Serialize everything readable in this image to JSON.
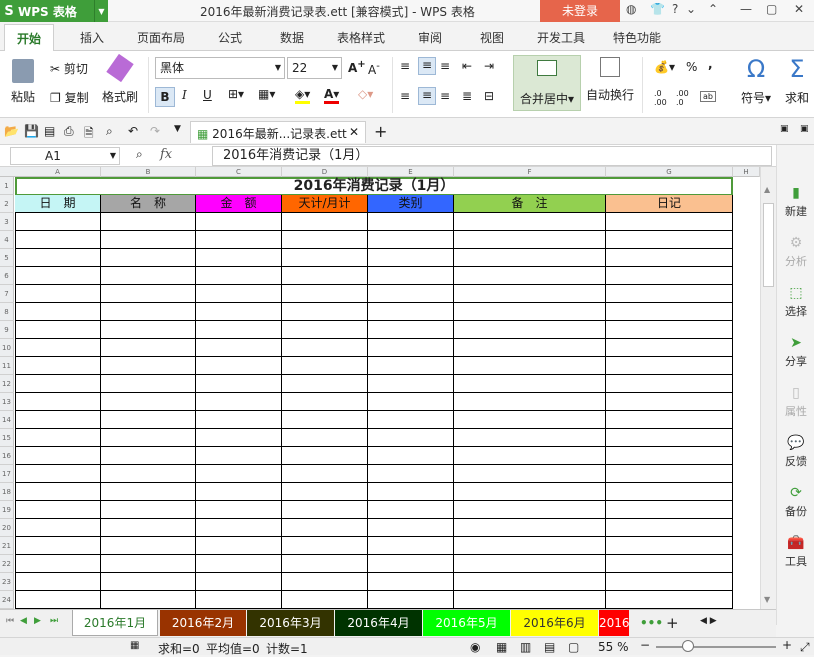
{
  "titlebar": {
    "app": "WPS 表格",
    "doc_title": "2016年最新消费记录表.ett [兼容模式] - WPS 表格",
    "login": "未登录"
  },
  "menu": [
    "开始",
    "插入",
    "页面布局",
    "公式",
    "数据",
    "表格样式",
    "审阅",
    "视图",
    "开发工具",
    "特色功能"
  ],
  "ribbon": {
    "paste": "粘贴",
    "cut": "剪切",
    "copy": "复制",
    "format_painter": "格式刷",
    "font": "黑体",
    "size": "22",
    "merge": "合并居中",
    "wrap": "自动换行",
    "symbol": "符号",
    "sum": "求和",
    "percent": "%",
    "comma": ","
  },
  "doc_tab": "2016年最新...记录表.ett",
  "formula": {
    "name": "A1",
    "fx": "fx",
    "content": "2016年消费记录（1月）"
  },
  "sheet": {
    "col_letters": [
      "A",
      "B",
      "C",
      "D",
      "E",
      "F",
      "G",
      "H"
    ],
    "title": "2016年消费记录（1月）",
    "headers": [
      "日　期",
      "名　称",
      "金　额",
      "天计/月计",
      "类别",
      "备　注",
      "日记"
    ],
    "header_colors": [
      "#c5f5f5",
      "#a6a6a6",
      "#ff00ff",
      "#ff6600",
      "#3366ff",
      "#92d050",
      "#fac090"
    ],
    "rows": [
      "1",
      "2",
      "3",
      "4",
      "5",
      "6",
      "7",
      "8",
      "9",
      "10",
      "11",
      "12",
      "13",
      "14",
      "15",
      "16",
      "17",
      "18",
      "19",
      "20",
      "21",
      "22",
      "23",
      "24"
    ]
  },
  "right_panel": [
    "新建",
    "分析",
    "选择",
    "分享",
    "属性",
    "反馈",
    "备份",
    "工具"
  ],
  "sheet_tabs": [
    {
      "label": "2016年1月",
      "bg": "#ffffff",
      "fg": "#2a7a2a"
    },
    {
      "label": "2016年2月",
      "bg": "#993300",
      "fg": "#ffffff"
    },
    {
      "label": "2016年3月",
      "bg": "#333300",
      "fg": "#ffffff"
    },
    {
      "label": "2016年4月",
      "bg": "#003300",
      "fg": "#ffffff"
    },
    {
      "label": "2016年5月",
      "bg": "#00ff00",
      "fg": "#ffffff"
    },
    {
      "label": "2016年6月",
      "bg": "#ffff00",
      "fg": "#333333"
    },
    {
      "label": "2016",
      "bg": "#ff0000",
      "fg": "#ffffff"
    }
  ],
  "status": {
    "sum": "求和=0",
    "avg": "平均值=0",
    "count": "计数=1",
    "zoom": "55 %"
  }
}
